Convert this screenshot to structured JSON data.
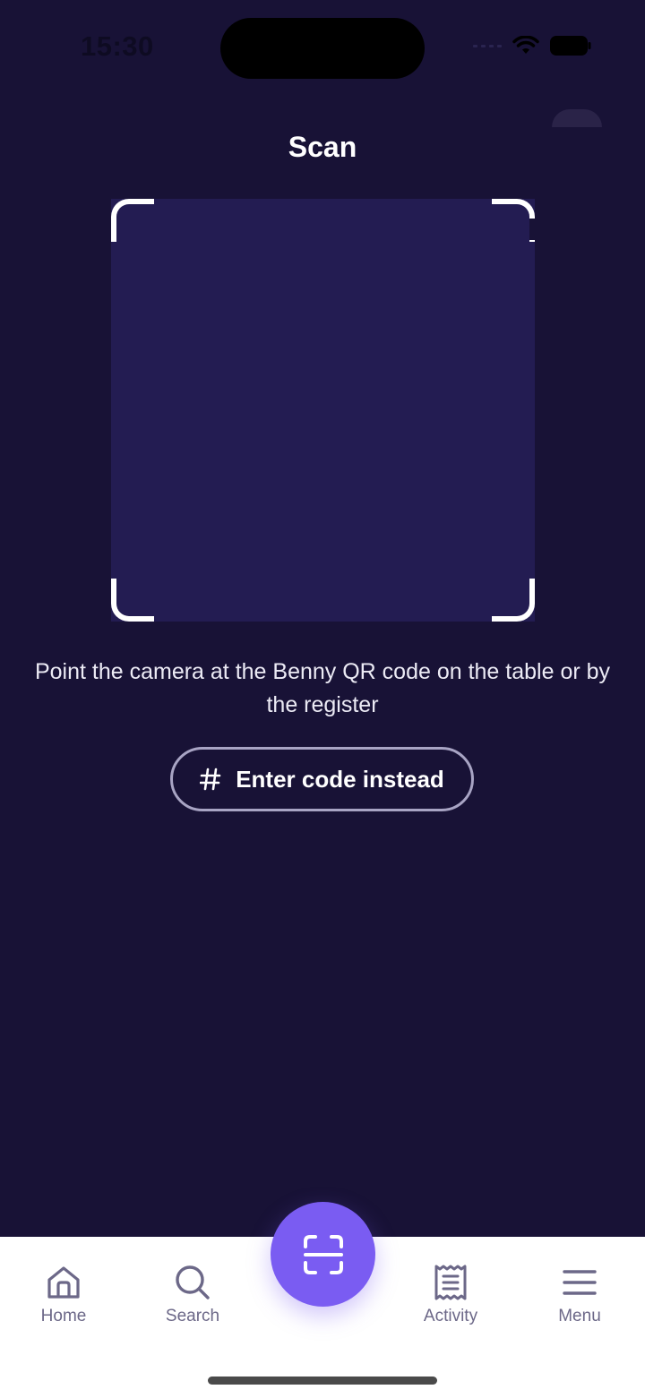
{
  "status_bar": {
    "time": "15:30"
  },
  "header": {
    "title": "Scan"
  },
  "scanner": {
    "instructions": "Point the camera at the Benny QR code on the table or by the register",
    "enter_code_label": "Enter code instead",
    "enter_code_icon": "hash-icon"
  },
  "bottom_nav": {
    "items": [
      {
        "label": "Home",
        "icon": "home-icon"
      },
      {
        "label": "Search",
        "icon": "search-icon"
      },
      {
        "label": "Activity",
        "icon": "receipt-icon"
      },
      {
        "label": "Menu",
        "icon": "hamburger-icon"
      }
    ],
    "scan_button_icon": "scan-icon"
  },
  "colors": {
    "background": "#181236",
    "viewfinder": "#231c52",
    "accent": "#7a5cf2",
    "nav_inactive": "#6c6888"
  }
}
